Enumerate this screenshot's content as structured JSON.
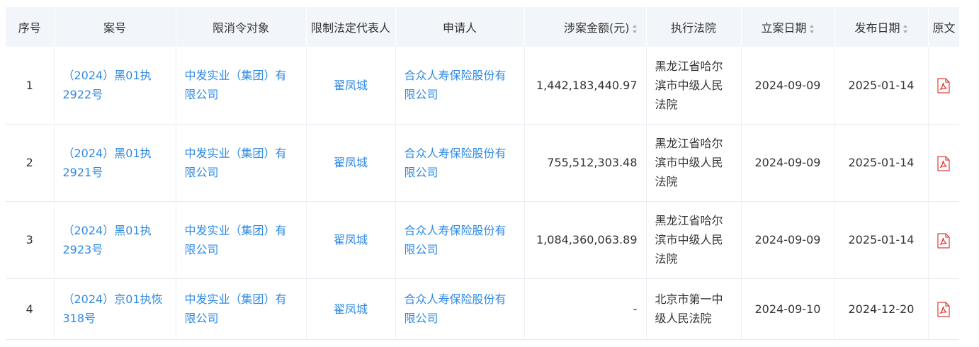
{
  "columns": {
    "seq": "序号",
    "case_no": "案号",
    "target": "限消令对象",
    "legal_rep": "限制法定代表人",
    "applicant": "申请人",
    "amount": "涉案金额(元)",
    "court": "执行法院",
    "filing_date": "立案日期",
    "publish_date": "发布日期",
    "original": "原文"
  },
  "rows": [
    {
      "seq": "1",
      "case_no": "（2024）黑01执2922号",
      "target": "中发实业（集团）有限公司",
      "legal_rep": "翟凤城",
      "applicant": "合众人寿保险股份有限公司",
      "amount": "1,442,183,440.97",
      "court": "黑龙江省哈尔滨市中级人民法院",
      "filing_date": "2024-09-09",
      "publish_date": "2025-01-14",
      "original_icon": "pdf-icon"
    },
    {
      "seq": "2",
      "case_no": "（2024）黑01执2921号",
      "target": "中发实业（集团）有限公司",
      "legal_rep": "翟凤城",
      "applicant": "合众人寿保险股份有限公司",
      "amount": "755,512,303.48",
      "court": "黑龙江省哈尔滨市中级人民法院",
      "filing_date": "2024-09-09",
      "publish_date": "2025-01-14",
      "original_icon": "pdf-icon"
    },
    {
      "seq": "3",
      "case_no": "（2024）黑01执2923号",
      "target": "中发实业（集团）有限公司",
      "legal_rep": "翟凤城",
      "applicant": "合众人寿保险股份有限公司",
      "amount": "1,084,360,063.89",
      "court": "黑龙江省哈尔滨市中级人民法院",
      "filing_date": "2024-09-09",
      "publish_date": "2025-01-14",
      "original_icon": "pdf-icon"
    },
    {
      "seq": "4",
      "case_no": "（2024）京01执恢318号",
      "target": "中发实业（集团）有限公司",
      "legal_rep": "翟凤城",
      "applicant": "合众人寿保险股份有限公司",
      "amount": "-",
      "court": "北京市第一中级人民法院",
      "filing_date": "2024-09-10",
      "publish_date": "2024-12-20",
      "original_icon": "pdf-icon"
    }
  ],
  "colors": {
    "link": "#2f8ae4",
    "header_bg": "#f2f5fa",
    "pdf_red": "#e23a3a"
  }
}
